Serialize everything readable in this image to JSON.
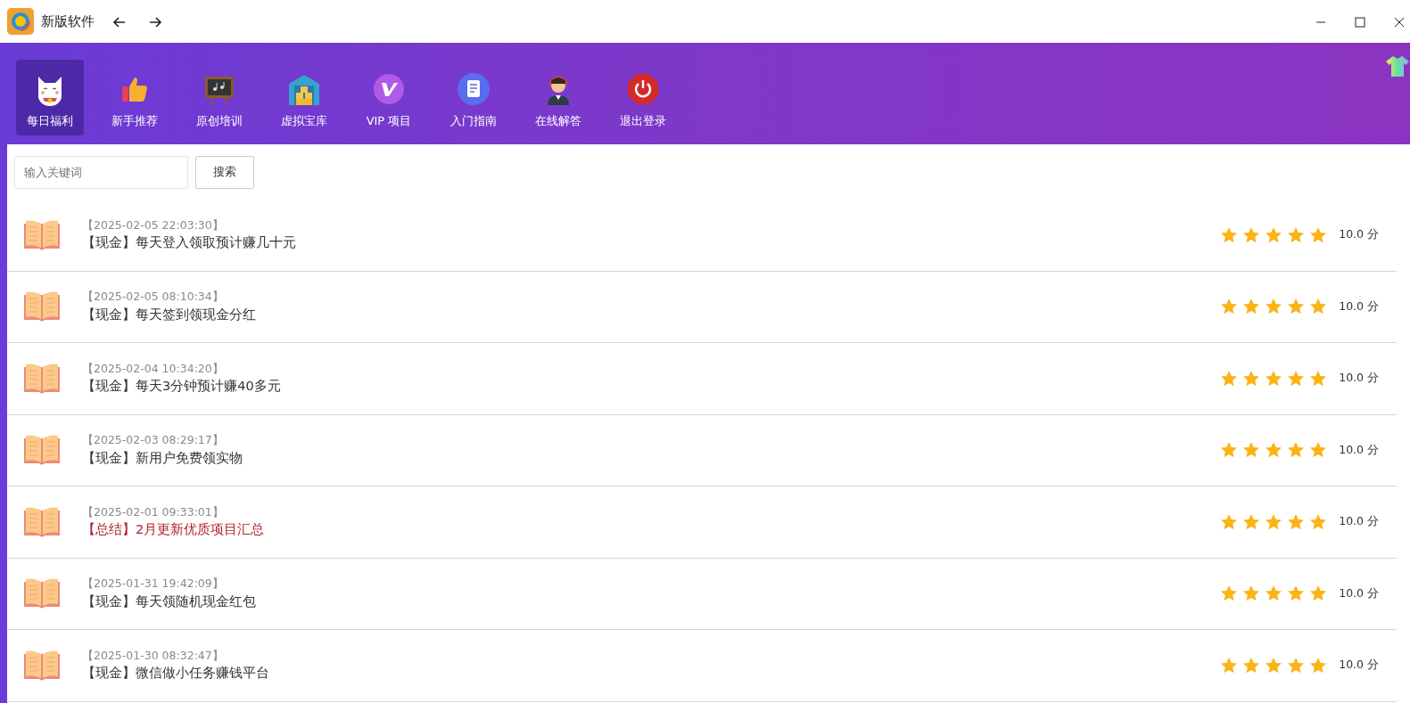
{
  "window": {
    "title": "新版软件"
  },
  "nav": [
    {
      "label": "每日福利",
      "selected": true
    },
    {
      "label": "新手推荐",
      "selected": false
    },
    {
      "label": "原创培训",
      "selected": false
    },
    {
      "label": "虚拟宝库",
      "selected": false
    },
    {
      "label": "VIP 项目",
      "selected": false
    },
    {
      "label": "入门指南",
      "selected": false
    },
    {
      "label": "在线解答",
      "selected": false
    },
    {
      "label": "退出登录",
      "selected": false
    }
  ],
  "search": {
    "placeholder": "输入关键词",
    "button": "搜索"
  },
  "items": [
    {
      "time": "【2025-02-05 22:03:30】",
      "title": "【现金】每天登入领取预计赚几十元",
      "highlighted": false,
      "stars": 5,
      "score": "10.0 分"
    },
    {
      "time": "【2025-02-05 08:10:34】",
      "title": "【现金】每天签到领现金分红",
      "highlighted": false,
      "stars": 5,
      "score": "10.0 分"
    },
    {
      "time": "【2025-02-04 10:34:20】",
      "title": "【现金】每天3分钟预计赚40多元",
      "highlighted": false,
      "stars": 5,
      "score": "10.0 分"
    },
    {
      "time": "【2025-02-03 08:29:17】",
      "title": "【现金】新用户免费领实物",
      "highlighted": false,
      "stars": 5,
      "score": "10.0 分"
    },
    {
      "time": "【2025-02-01 09:33:01】",
      "title": "【总结】2月更新优质项目汇总",
      "highlighted": true,
      "stars": 5,
      "score": "10.0 分"
    },
    {
      "time": "【2025-01-31 19:42:09】",
      "title": "【现金】每天领随机现金红包",
      "highlighted": false,
      "stars": 5,
      "score": "10.0 分"
    },
    {
      "time": "【2025-01-30 08:32:47】",
      "title": "【现金】微信做小任务赚钱平台",
      "highlighted": false,
      "stars": 5,
      "score": "10.0 分"
    }
  ]
}
